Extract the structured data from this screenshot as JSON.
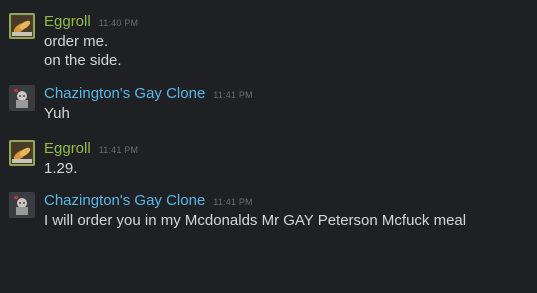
{
  "colors": {
    "background": "#1f2024",
    "eggroll_name": "#8fbf46",
    "clone_name": "#57b8e8",
    "message_text": "#d6d6d6",
    "timestamp": "#6b6e74"
  },
  "messages": [
    {
      "author": "Eggroll",
      "time": "11:40 PM",
      "avatar_icon": "eggroll-food-avatar-icon",
      "lines": [
        "order me.",
        "on the side."
      ]
    },
    {
      "author": "Chazington's Gay Clone",
      "time": "11:41 PM",
      "avatar_icon": "clone-avatar-icon",
      "lines": [
        "Yuh"
      ]
    },
    {
      "author": "Eggroll",
      "time": "11:41 PM",
      "avatar_icon": "eggroll-food-avatar-icon",
      "lines": [
        "1.29."
      ]
    },
    {
      "author": "Chazington's Gay Clone",
      "time": "11:41 PM",
      "avatar_icon": "clone-avatar-icon",
      "lines": [
        "I will order you in my Mcdonalds Mr GAY Peterson Mcfuck meal"
      ]
    }
  ]
}
